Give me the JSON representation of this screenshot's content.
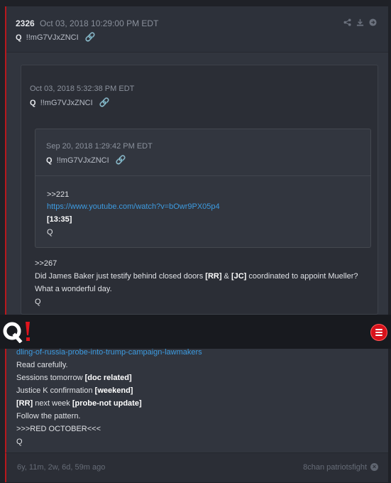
{
  "post": {
    "id": "2326",
    "date": "Oct 03, 2018 10:29:00 PM EDT",
    "author_q": "Q",
    "tripcode": "!!mG7VJxZNCI"
  },
  "quote1": {
    "date": "Oct 03, 2018 5:32:38 PM EDT",
    "author_q": "Q",
    "tripcode": "!!mG7VJxZNCI",
    "lines": {
      "l1": ">>267",
      "l2a": "Did James Baker just testify behind closed doors ",
      "l2b": "[RR]",
      "l2c": " & ",
      "l2d": "[JC]",
      "l2e": " coordinated to appoint Mueller?",
      "l3": "What a wonderful day.",
      "l4": "Q"
    }
  },
  "quote2": {
    "date": "Sep 20, 2018 1:29:42 PM EDT",
    "author_q": "Q",
    "tripcode": "!!mG7VJxZNCI",
    "lines": {
      "l1": ">>221",
      "l2": "https://www.youtube.com/watch?v=bOwr9PX05p4",
      "l3": "[13:35]",
      "l4": "Q"
    }
  },
  "body": {
    "link_partial": "dling-of-russia-probe-into-trump-campaign-lawmakers",
    "read": "Read carefully.",
    "sessions_a": "Sessions tomorrow ",
    "sessions_b": "[doc related]",
    "justice_a": "Justice K confirmation ",
    "justice_b": "[weekend]",
    "rr_a": "[RR]",
    "rr_b": " next week ",
    "rr_c": "[probe-not update]",
    "follow": "Follow the pattern.",
    "red": ">>>RED OCTOBER<<<",
    "sign": "Q"
  },
  "footer": {
    "ago": "6y, 11m, 2w, 6d, 59m ago",
    "source": "8chan patriotsfight"
  },
  "colors": {
    "accent": "#d8121b",
    "link": "#3d9be0"
  },
  "icons": [
    "share-icon",
    "download-icon",
    "arrow-right-icon",
    "link-icon",
    "q-logo",
    "menu-icon",
    "close-icon"
  ]
}
